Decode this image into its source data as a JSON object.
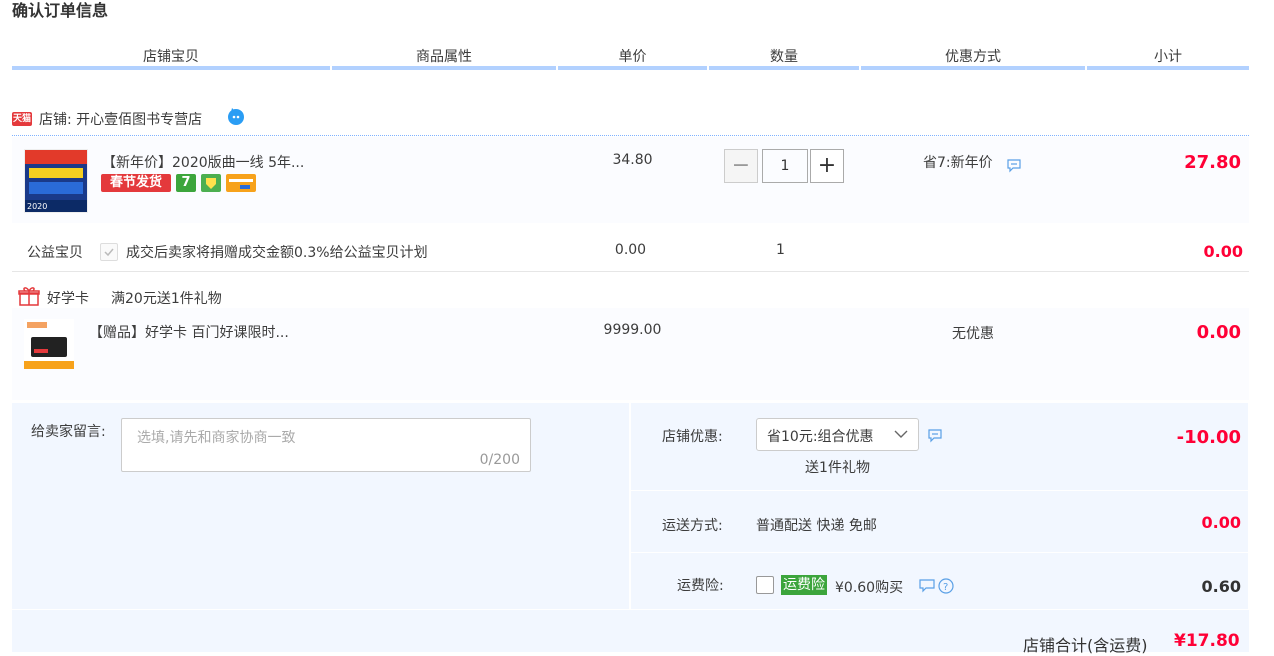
{
  "page": {
    "title": "确认订单信息"
  },
  "columns": [
    "店铺宝贝",
    "商品属性",
    "单价",
    "数量",
    "优惠方式",
    "小计"
  ],
  "shop": {
    "badge": "天猫",
    "label": "店铺:",
    "name": "开心壹佰图书专营店"
  },
  "item1": {
    "title": "【新年价】2020版曲一线 5年...",
    "tags": {
      "spring": "春节发货",
      "seven": "7"
    },
    "unit_price": "34.80",
    "quantity": "1",
    "minus": "−",
    "plus": "+",
    "discount": "省7:新年价",
    "subtotal": "27.80"
  },
  "charity": {
    "label": "公益宝贝",
    "text": "成交后卖家将捐赠成交金额0.3%给公益宝贝计划",
    "unit_price": "0.00",
    "quantity": "1",
    "subtotal": "0.00"
  },
  "gift": {
    "label": "好学卡",
    "text": "满20元送1件礼物"
  },
  "item2": {
    "title": "【赠品】好学卡 百门好课限时...",
    "unit_price": "9999.00",
    "discount": "无优惠",
    "subtotal": "0.00"
  },
  "message": {
    "label": "给卖家留言:",
    "placeholder": "选填,请先和商家协商一致",
    "counter": "0/200"
  },
  "shop_discount": {
    "label": "店铺优惠:",
    "selected": "省10元:组合优惠",
    "note": "送1件礼物",
    "amount": "-10.00"
  },
  "shipping": {
    "label": "运送方式:",
    "value": "普通配送 快递 免邮",
    "amount": "0.00"
  },
  "insurance": {
    "label": "运费险:",
    "tag": "运费险",
    "text": "¥0.60购买",
    "amount": "0.60"
  },
  "total": {
    "label": "店铺合计(含运费)",
    "amount": "¥17.80"
  },
  "colors": {
    "accent_red": "#ff0036",
    "header_bar": "#b2d1ff",
    "panel_bg": "#f2f7ff",
    "insurance_green": "#3ca53c"
  }
}
